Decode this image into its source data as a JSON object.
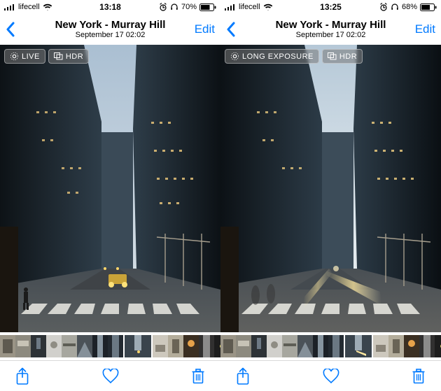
{
  "colors": {
    "ios_blue": "#007aff"
  },
  "screens": [
    {
      "status": {
        "carrier": "lifecell",
        "time": "13:18",
        "battery_percent": "70%"
      },
      "nav": {
        "title": "New York - Murray Hill",
        "subtitle": "September 17  02:02",
        "edit_label": "Edit"
      },
      "badges": {
        "primary": "LIVE",
        "secondary": "HDR"
      }
    },
    {
      "status": {
        "carrier": "lifecell",
        "time": "13:25",
        "battery_percent": "68%"
      },
      "nav": {
        "title": "New York - Murray Hill",
        "subtitle": "September 17  02:02",
        "edit_label": "Edit"
      },
      "badges": {
        "primary": "LONG EXPOSURE",
        "secondary": "HDR"
      }
    }
  ]
}
